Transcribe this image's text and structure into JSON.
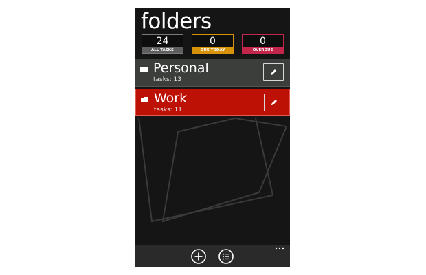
{
  "page": {
    "title": "folders"
  },
  "counters": [
    {
      "value": "24",
      "label": "ALL TASKS",
      "color": "#5e5e5e"
    },
    {
      "value": "0",
      "label": "DUE TODAY",
      "color": "#d6930a"
    },
    {
      "value": "0",
      "label": "OVERDUE",
      "color": "#c2264a"
    }
  ],
  "folders": [
    {
      "name": "Personal",
      "tasks": "tasks: 13",
      "color": "#3c3e3c"
    },
    {
      "name": "Work",
      "tasks": "tasks: 11",
      "color": "#be1106"
    }
  ],
  "appbar": {
    "icons": [
      "add-icon",
      "list-icon",
      "more-icon"
    ]
  }
}
